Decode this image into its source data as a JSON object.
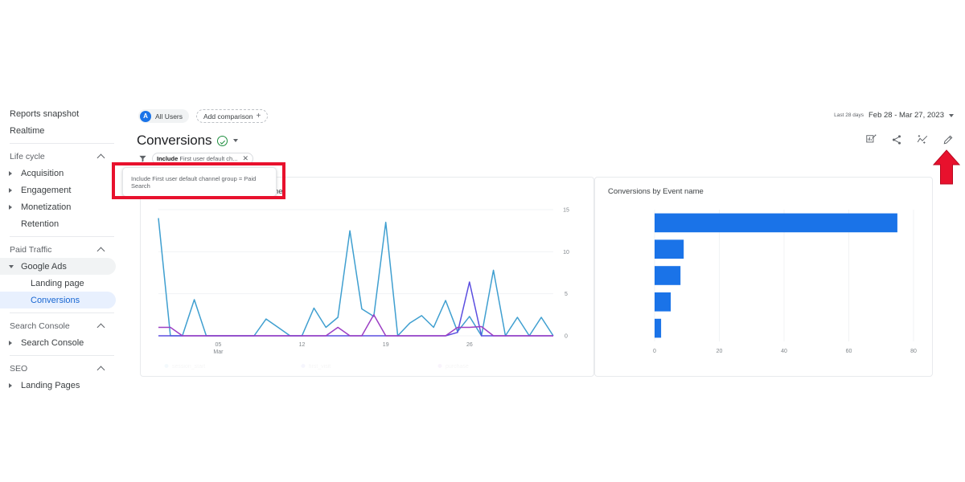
{
  "app": {
    "account_chip": "All Users",
    "avatar_letter": "A",
    "add_comparison": "Add comparison",
    "date_label": "Last 28 days",
    "date_range": "Feb 28 - Mar 27, 2023",
    "page_title": "Conversions"
  },
  "filter": {
    "chip_prefix": "Include",
    "chip_text": "First user default ch...",
    "tooltip": "Include First user default channel group = Paid Search"
  },
  "toolbar": {
    "icons": [
      {
        "name": "insights-icon",
        "title": "Insights"
      },
      {
        "name": "share-icon",
        "title": "Share this report"
      },
      {
        "name": "compare-icon",
        "title": "Compare"
      },
      {
        "name": "edit-pencil-icon",
        "title": "Edit"
      }
    ]
  },
  "sidebar": {
    "top_items": [
      {
        "label": "Reports snapshot",
        "selected": false,
        "expandable": false
      },
      {
        "label": "Realtime",
        "selected": false,
        "expandable": false
      }
    ],
    "sections": [
      {
        "heading": "Life cycle",
        "items": [
          {
            "label": "Acquisition",
            "expandable": true,
            "selected": false,
            "sub": false
          },
          {
            "label": "Engagement",
            "expandable": true,
            "selected": false,
            "sub": false
          },
          {
            "label": "Monetization",
            "expandable": true,
            "selected": false,
            "sub": false
          },
          {
            "label": "Retention",
            "expandable": false,
            "selected": false,
            "sub": false
          }
        ]
      },
      {
        "heading": "Paid Traffic",
        "items": [
          {
            "label": "Google Ads",
            "expandable": true,
            "expanded": true,
            "selected": false,
            "grey": true,
            "sub": false
          },
          {
            "label": "Landing page",
            "expandable": false,
            "selected": false,
            "sub": true
          },
          {
            "label": "Conversions",
            "expandable": false,
            "selected": true,
            "sub": true
          }
        ]
      },
      {
        "heading": "Search Console",
        "items": [
          {
            "label": "Search Console",
            "expandable": true,
            "selected": false,
            "sub": false
          }
        ]
      },
      {
        "heading": "SEO",
        "items": [
          {
            "label": "Landing Pages",
            "expandable": true,
            "selected": false,
            "sub": false
          }
        ]
      }
    ]
  },
  "chart_data": [
    {
      "type": "line",
      "title": "Conversions by Event name over time",
      "xlabel": "",
      "ylabel": "",
      "ylim": [
        0,
        15
      ],
      "yticks": [
        0,
        5,
        10,
        15
      ],
      "xticks": [
        "05",
        "12",
        "19",
        "26"
      ],
      "xtick_sub": "Mar",
      "grid": true,
      "legend": "bottom",
      "series": [
        {
          "name": "session_start",
          "color": "#3f9fd0",
          "values": [
            14,
            0,
            0,
            4.3,
            0,
            0,
            0,
            0,
            0,
            2,
            1,
            0,
            0,
            3.3,
            1,
            2.2,
            12.5,
            3.2,
            2.3,
            13.5,
            0,
            1.5,
            2.4,
            1,
            4.2,
            0.5,
            2.3,
            0,
            7.8,
            0,
            2.2,
            0,
            2.2,
            0
          ]
        },
        {
          "name": "first_visit",
          "color": "#5b4ee0",
          "values": [
            0,
            0,
            0,
            0,
            0,
            0,
            0,
            0,
            0,
            0,
            0,
            0,
            0,
            0,
            0,
            0,
            0,
            0,
            0,
            0,
            0,
            0,
            0,
            0,
            0,
            0.4,
            6.4,
            0,
            0,
            0,
            0,
            0,
            0,
            0
          ]
        },
        {
          "name": "purchase",
          "color": "#9c3fc4",
          "values": [
            1,
            1,
            0,
            0,
            0,
            0,
            0,
            0,
            0,
            0,
            0,
            0,
            0,
            0,
            0,
            1,
            0,
            0,
            2.5,
            0,
            0,
            0,
            0,
            0,
            0,
            1,
            1,
            1.1,
            0,
            0,
            0,
            0,
            0,
            0
          ]
        }
      ]
    },
    {
      "type": "bar",
      "orientation": "horizontal",
      "title": "Conversions by Event name",
      "xlabel": "",
      "ylabel": "",
      "xlim": [
        0,
        80
      ],
      "xticks": [
        0,
        20,
        40,
        60,
        80
      ],
      "categories": [
        "",
        "",
        "",
        "",
        ""
      ],
      "values": [
        75,
        9,
        8,
        5,
        2
      ],
      "bar_color": "#1a73e8",
      "grid": true
    }
  ]
}
